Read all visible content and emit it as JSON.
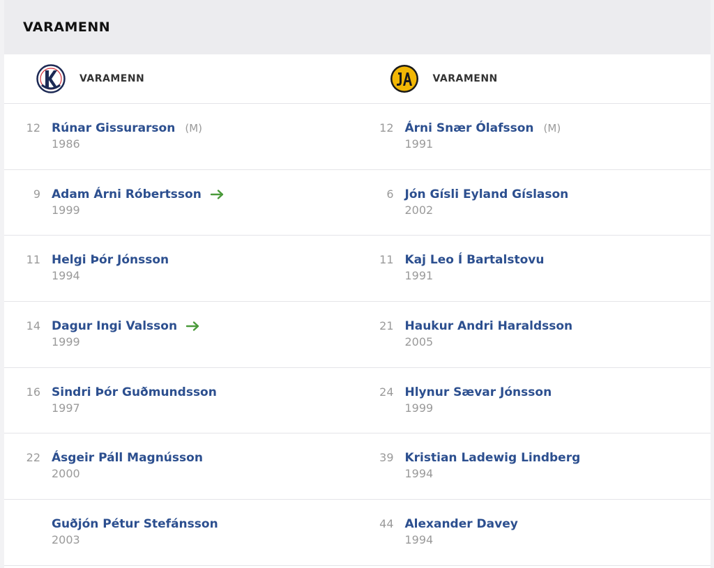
{
  "section": {
    "title": "VARAMENN"
  },
  "teams": {
    "left": {
      "label": "VARAMENN",
      "logo_icon": "keflavik-logo-icon",
      "logo_text": "KEFLAVÍK"
    },
    "right": {
      "label": "VARAMENN",
      "logo_icon": "ia-logo-icon",
      "logo_text": "IA"
    }
  },
  "colors": {
    "name": "#2c4f8f",
    "muted": "#9a9a9a",
    "sub_arrow": "#4a9a3a",
    "header_bg": "#ececef"
  },
  "left": [
    {
      "number": "12",
      "name": "Rúnar Gissurarson",
      "tag": "(M)",
      "year": "1986",
      "sub": false
    },
    {
      "number": "9",
      "name": "Adam Árni Róbertsson",
      "tag": "",
      "year": "1999",
      "sub": true
    },
    {
      "number": "11",
      "name": "Helgi Þór Jónsson",
      "tag": "",
      "year": "1994",
      "sub": false
    },
    {
      "number": "14",
      "name": "Dagur Ingi Valsson",
      "tag": "",
      "year": "1999",
      "sub": true
    },
    {
      "number": "16",
      "name": "Sindri Þór Guðmundsson",
      "tag": "",
      "year": "1997",
      "sub": false
    },
    {
      "number": "22",
      "name": "Ásgeir Páll Magnússon",
      "tag": "",
      "year": "2000",
      "sub": false
    },
    {
      "number": "",
      "name": "Guðjón Pétur Stefánsson",
      "tag": "",
      "year": "2003",
      "sub": false
    }
  ],
  "right": [
    {
      "number": "12",
      "name": "Árni Snær Ólafsson",
      "tag": "(M)",
      "year": "1991",
      "sub": false
    },
    {
      "number": "6",
      "name": "Jón Gísli Eyland Gíslason",
      "tag": "",
      "year": "2002",
      "sub": false
    },
    {
      "number": "11",
      "name": "Kaj Leo Í Bartalstovu",
      "tag": "",
      "year": "1991",
      "sub": false
    },
    {
      "number": "21",
      "name": "Haukur Andri Haraldsson",
      "tag": "",
      "year": "2005",
      "sub": false
    },
    {
      "number": "24",
      "name": "Hlynur Sævar Jónsson",
      "tag": "",
      "year": "1999",
      "sub": false
    },
    {
      "number": "39",
      "name": "Kristian Ladewig Lindberg",
      "tag": "",
      "year": "1994",
      "sub": false
    },
    {
      "number": "44",
      "name": "Alexander Davey",
      "tag": "",
      "year": "1994",
      "sub": false
    }
  ]
}
